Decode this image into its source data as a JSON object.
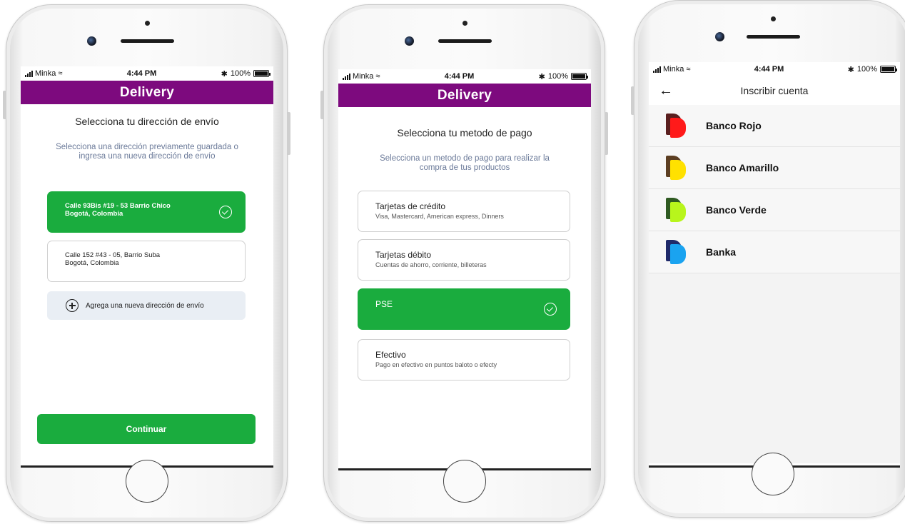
{
  "status": {
    "carrier": "Minka",
    "time": "4:44 PM",
    "battery": "100%"
  },
  "screen1": {
    "app_title": "Delivery",
    "heading": "Selecciona tu dirección de envío",
    "subtitle": "Selecciona una dirección previamente guardada o ingresa una nueva dirección de envío",
    "addresses": [
      {
        "line1": "Calle 93Bis #19 - 53 Barrio Chico",
        "line2": "Bogotá, Colombia",
        "selected": true
      },
      {
        "line1": "Calle 152 #43 - 05, Barrio Suba",
        "line2": "Bogotá, Colombia",
        "selected": false
      }
    ],
    "add_label": "Agrega una  nueva dirección de envío",
    "continue_label": "Continuar"
  },
  "screen2": {
    "app_title": "Delivery",
    "heading": "Selecciona tu metodo de pago",
    "subtitle": "Selecciona un metodo de pago para realizar la compra de tus productos",
    "methods": [
      {
        "title": "Tarjetas de crédito",
        "desc": "Visa, Mastercard, American express, Dinners",
        "selected": false
      },
      {
        "title": "Tarjetas débito",
        "desc": "Cuentas de ahorro, corriente, billeteras",
        "selected": false
      },
      {
        "title": "PSE",
        "desc": "",
        "selected": true
      },
      {
        "title": "Efectivo",
        "desc": "Pago en efectivo en puntos baloto o efecty",
        "selected": false
      }
    ]
  },
  "screen3": {
    "title": "Inscribir cuenta",
    "banks": [
      {
        "name": "Banco Rojo",
        "dark": "#5a1f1f",
        "color": "#ff1a1a"
      },
      {
        "name": "Banco Amarillo",
        "dark": "#5c3e22",
        "color": "#ffe100"
      },
      {
        "name": "Banco Verde",
        "dark": "#2f5a22",
        "color": "#b8f51c"
      },
      {
        "name": "Banka",
        "dark": "#1f2a6a",
        "color": "#1aa3f0"
      }
    ]
  },
  "colors": {
    "brand": "#7d0a7e",
    "accent": "#1aac3e"
  }
}
